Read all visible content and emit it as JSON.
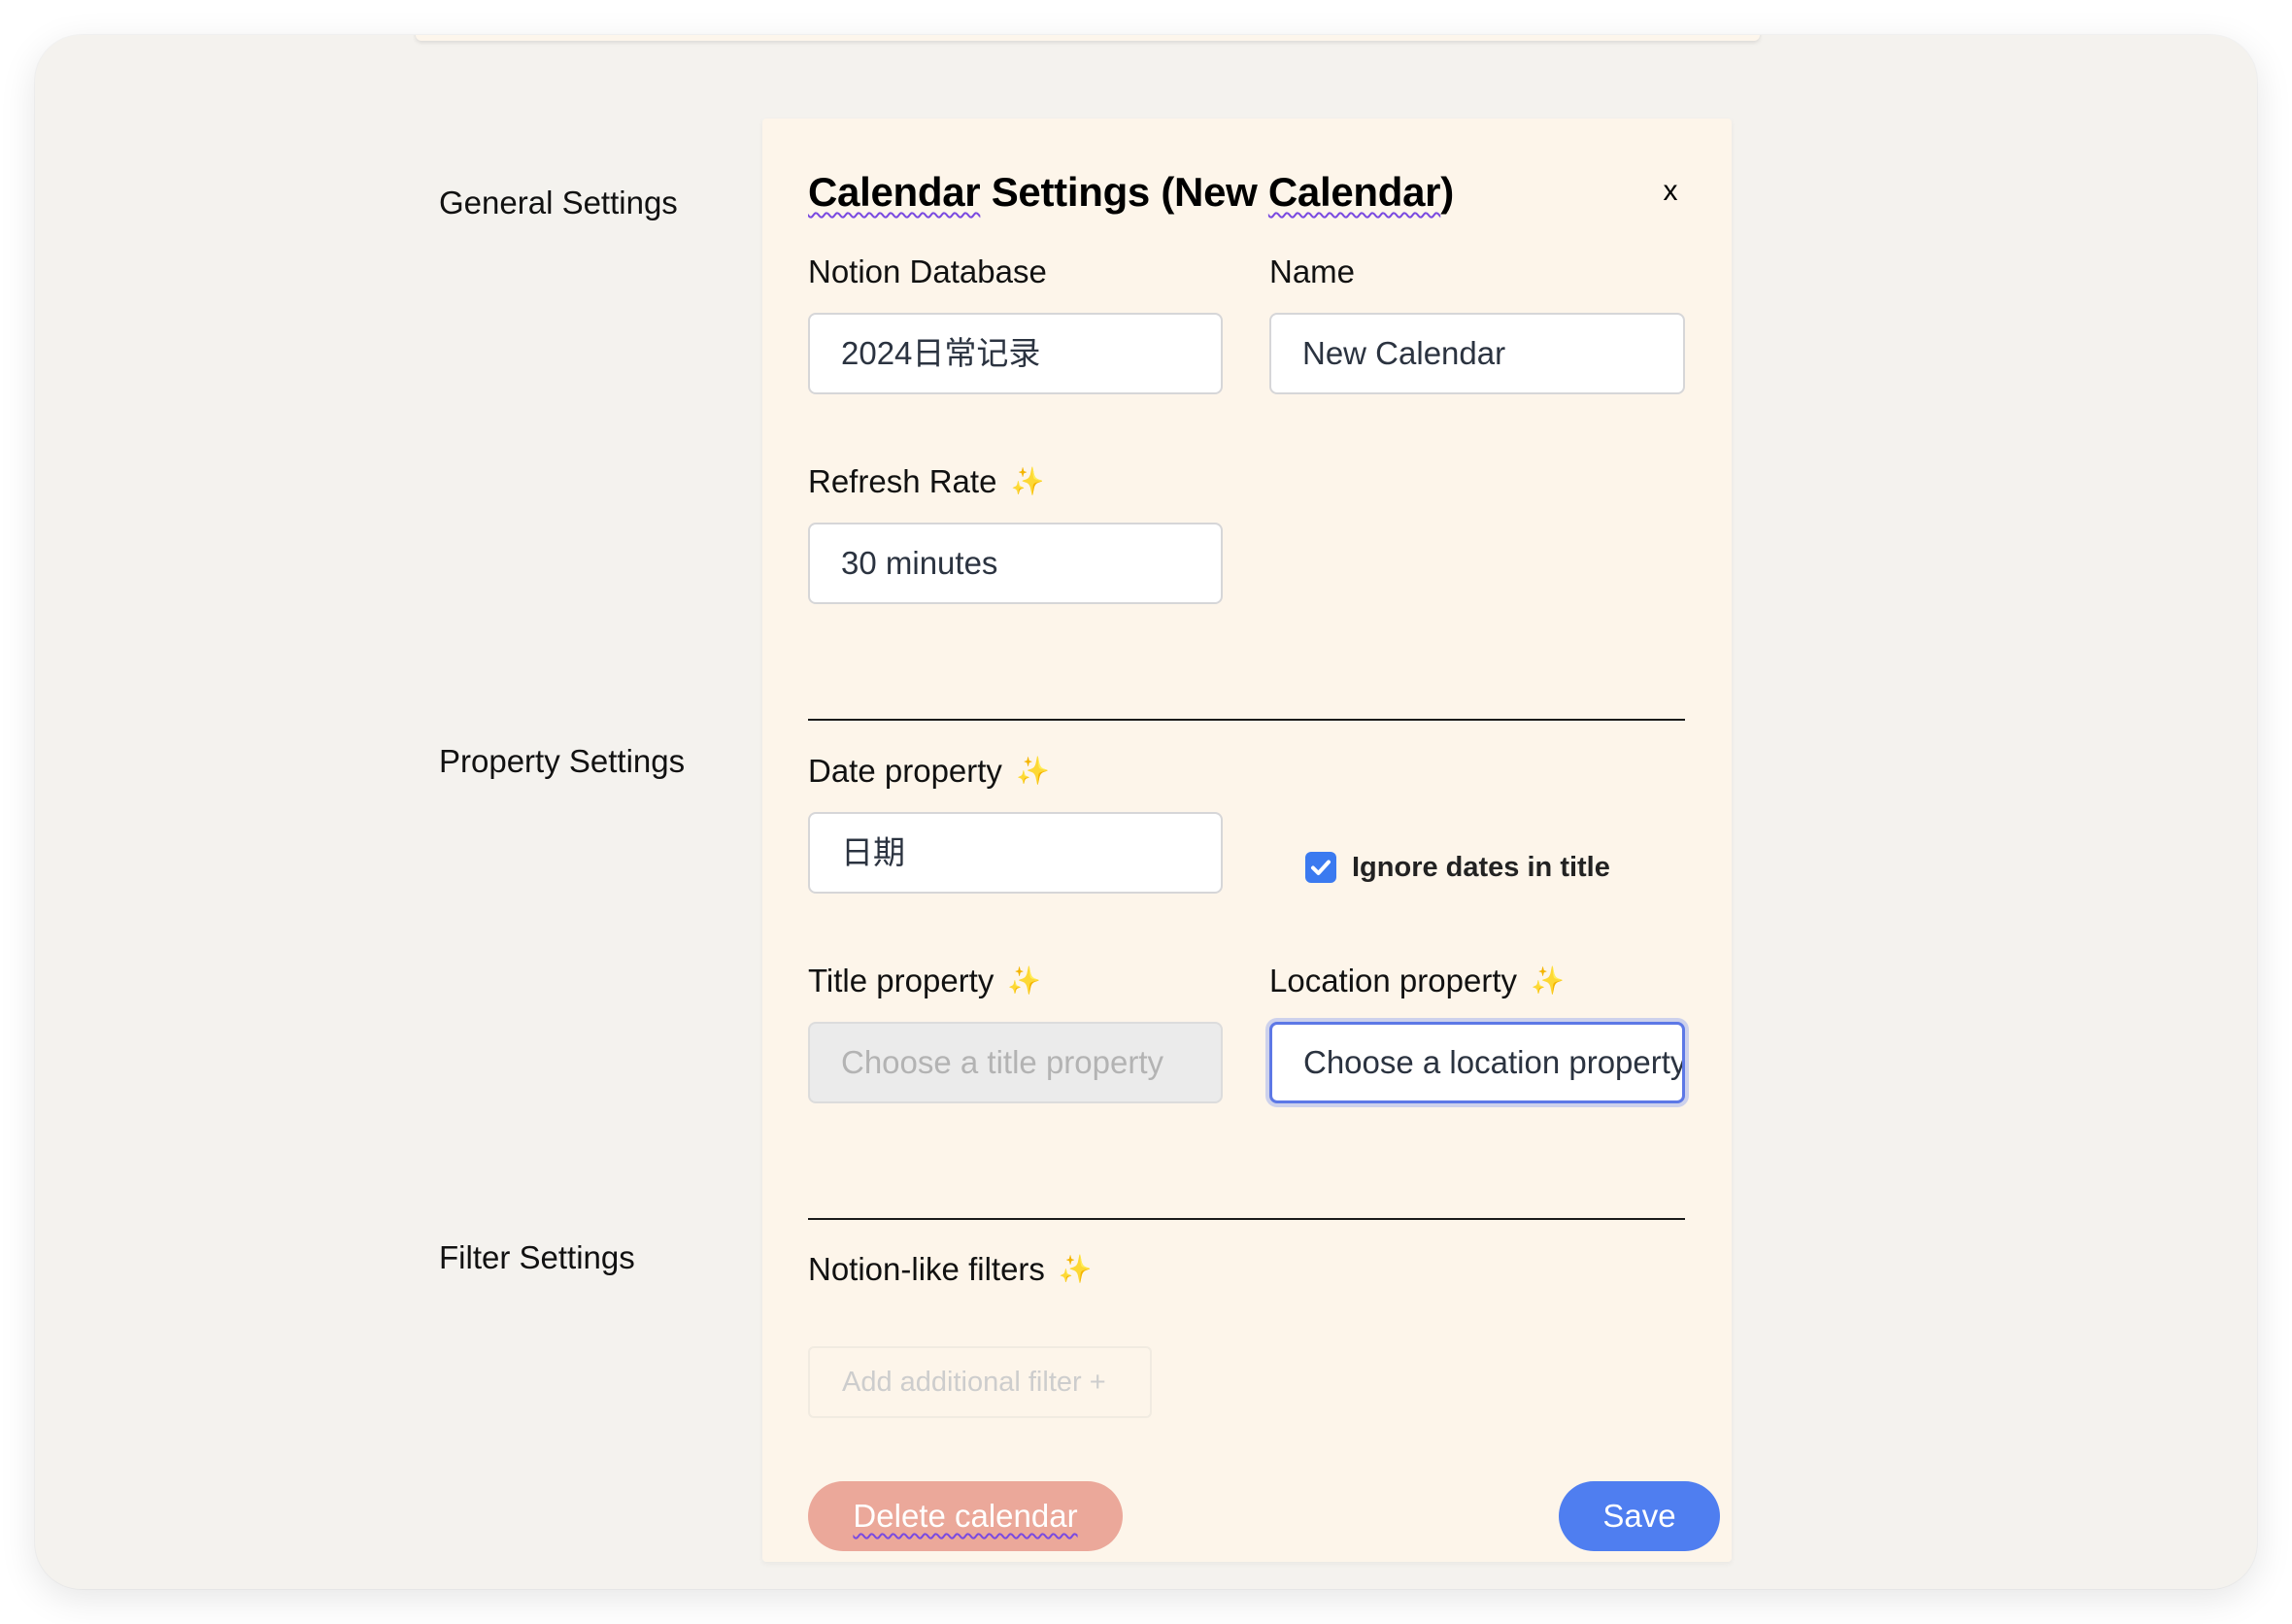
{
  "sections": {
    "general": "General Settings",
    "property": "Property Settings",
    "filter": "Filter Settings"
  },
  "dialog": {
    "title_part1": "Calendar",
    "title_part2": " Settings (New ",
    "title_part3": "Calendar",
    "title_part4": ")",
    "close_label": "x"
  },
  "fields": {
    "notion_database": {
      "label": "Notion Database",
      "value": "2024日常记录"
    },
    "name": {
      "label": "Name",
      "value": "New Calendar"
    },
    "refresh_rate": {
      "label": "Refresh Rate",
      "value": "30 minutes"
    },
    "date_property": {
      "label": "Date property",
      "value": "日期"
    },
    "ignore_dates": {
      "label": "Ignore dates in title",
      "checked": true
    },
    "title_property": {
      "label": "Title property",
      "placeholder": "Choose a title property"
    },
    "location_property": {
      "label": "Location property",
      "placeholder": "Choose a location property"
    },
    "filters": {
      "label": "Notion-like filters",
      "add_label": "Add additional filter +"
    }
  },
  "icons": {
    "sparkle": "✨",
    "close": "close-icon",
    "check": "checkmark-icon"
  },
  "buttons": {
    "delete": "Delete calendar",
    "save": "Save"
  },
  "colors": {
    "accent": "#4f7ef0",
    "danger": "#eba89a",
    "panel_bg": "#fdf5ea",
    "checkbox": "#3b7af0",
    "sparkle": "#f0c23c"
  }
}
